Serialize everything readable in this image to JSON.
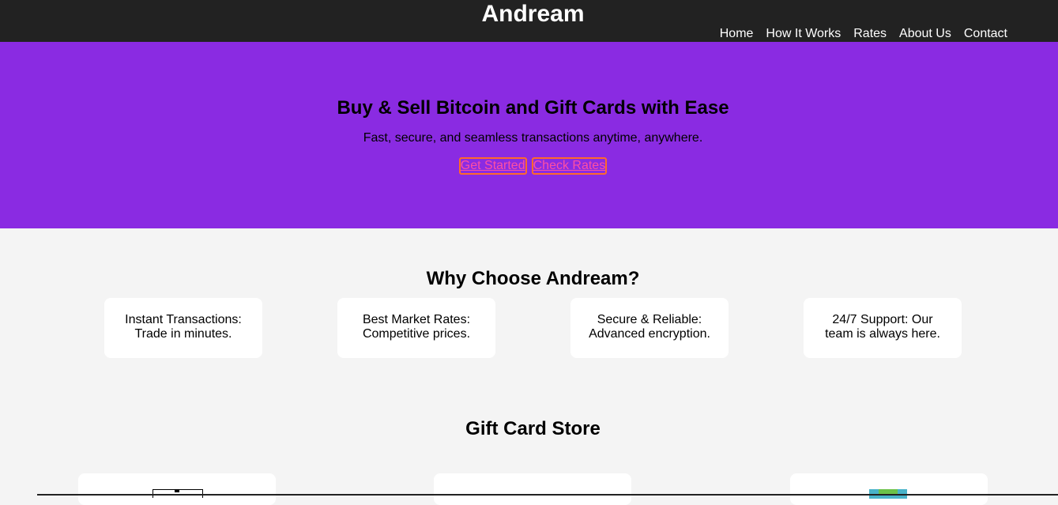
{
  "header": {
    "brand": "Andream",
    "nav": [
      "Home",
      "How It Works",
      "Rates",
      "About Us",
      "Contact"
    ]
  },
  "hero": {
    "title": "Buy & Sell Bitcoin and Gift Cards with Ease",
    "subtitle": "Fast, secure, and seamless transactions anytime, anywhere.",
    "buttons": [
      "Get Started",
      "Check Rates"
    ]
  },
  "features": {
    "title": "Why Choose Andream?",
    "items": [
      [
        "Instant Transactions:",
        "Trade in minutes."
      ],
      [
        "Best Market Rates:",
        "Competitive prices."
      ],
      [
        "Secure & Reliable:",
        "Advanced encryption."
      ],
      [
        "24/7 Support: Our",
        "team is always here."
      ]
    ]
  },
  "store": {
    "title": "Gift Card Store"
  },
  "colors": {
    "header_bg": "#222222",
    "hero_bg": "#8a2be2",
    "button_text": "#ff4fa3",
    "button_border": "#ff6a2a",
    "page_bg": "#f4f4f4"
  }
}
